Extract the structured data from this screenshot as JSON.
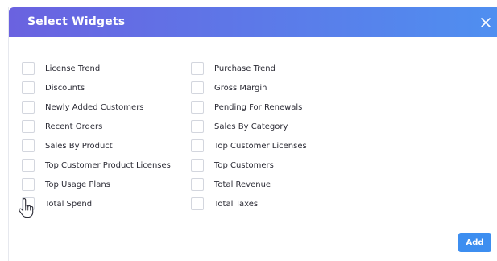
{
  "dialog": {
    "title": "Select Widgets",
    "close_icon": "close-icon",
    "add_label": "Add"
  },
  "colors": {
    "header_start": "#6a62e0",
    "header_end": "#4f8ff0",
    "add_button": "#3d8ef0"
  },
  "widgets": {
    "left": [
      {
        "label": "License Trend",
        "checked": false
      },
      {
        "label": "Discounts",
        "checked": false
      },
      {
        "label": "Newly Added Customers",
        "checked": false
      },
      {
        "label": "Recent Orders",
        "checked": false
      },
      {
        "label": "Sales By Product",
        "checked": false
      },
      {
        "label": "Top Customer Product Licenses",
        "checked": false
      },
      {
        "label": "Top Usage Plans",
        "checked": false
      },
      {
        "label": "Total Spend",
        "checked": false
      }
    ],
    "right": [
      {
        "label": "Purchase Trend",
        "checked": false
      },
      {
        "label": "Gross Margin",
        "checked": false
      },
      {
        "label": "Pending For Renewals",
        "checked": false
      },
      {
        "label": "Sales By Category",
        "checked": false
      },
      {
        "label": "Top Customer Licenses",
        "checked": false
      },
      {
        "label": "Top Customers",
        "checked": false
      },
      {
        "label": "Total Revenue",
        "checked": false
      },
      {
        "label": "Total Taxes",
        "checked": false
      }
    ]
  }
}
